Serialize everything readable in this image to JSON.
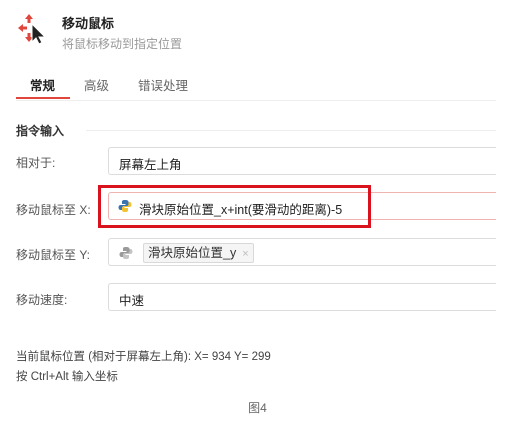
{
  "header": {
    "title": "移动鼠标",
    "subtitle": "将鼠标移动到指定位置"
  },
  "tabs": [
    {
      "label": "常规",
      "active": true
    },
    {
      "label": "高级",
      "active": false
    },
    {
      "label": "错误处理",
      "active": false
    }
  ],
  "section": {
    "title": "指令输入"
  },
  "rows": {
    "relative": {
      "label": "相对于:",
      "value": "屏幕左上角"
    },
    "move_x": {
      "label": "移动鼠标至  X:",
      "value": "滑块原始位置_x+int(要滑动的距离)-5"
    },
    "move_y": {
      "label": "移动鼠标至  Y:",
      "chip": "滑块原始位置_y",
      "chip_close": "×"
    },
    "speed": {
      "label": "移动速度:",
      "value": "中速"
    }
  },
  "info": {
    "position": "当前鼠标位置 (相对于屏幕左上角):  X= 934 Y= 299",
    "hint": "按 Ctrl+Alt 输入坐标"
  },
  "figure_caption": "图4",
  "colors": {
    "accent": "#e0463c",
    "highlight_box": "#d9121e"
  },
  "icons": {
    "header": "move-cursor-icon",
    "python": "python-icon"
  }
}
